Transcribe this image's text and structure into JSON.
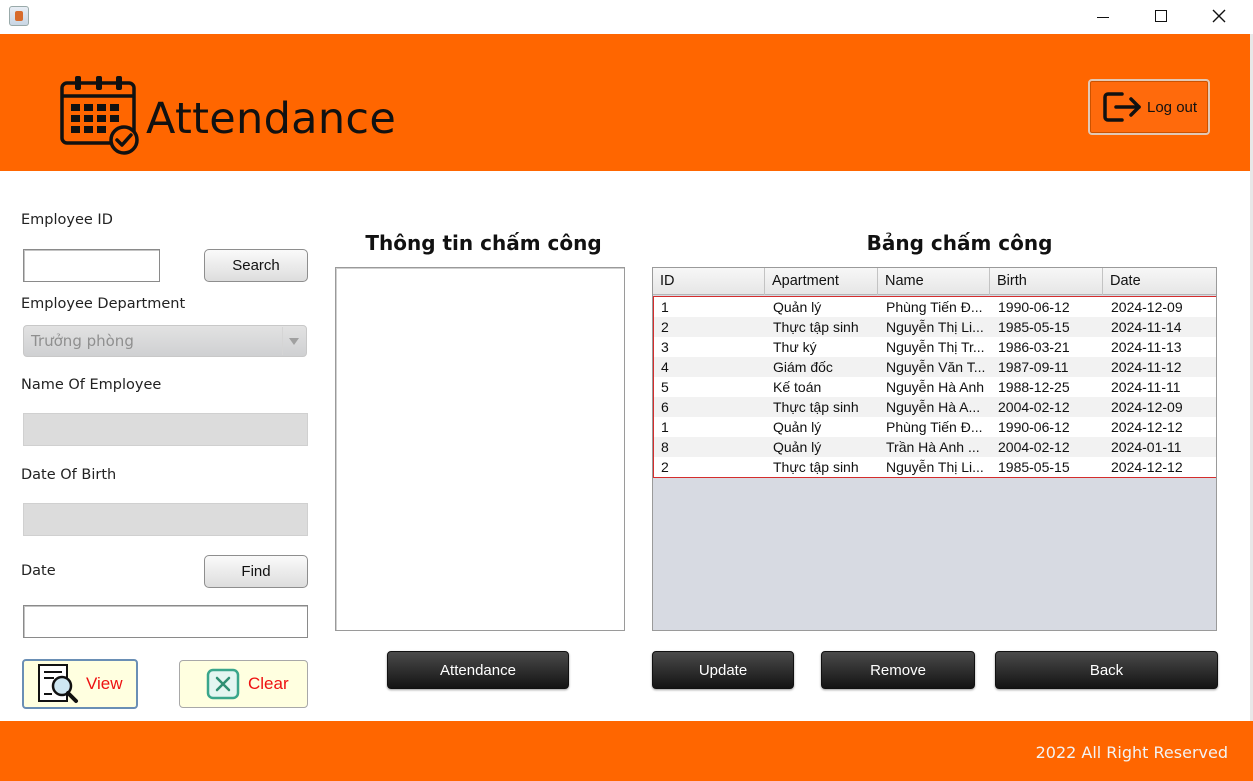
{
  "header": {
    "title": "Attendance",
    "logout_label": "Log out",
    "accent_color": "#ff6600"
  },
  "form": {
    "employee_id_label": "Employee ID",
    "employee_id_value": "",
    "search_label": "Search",
    "department_label": "Employee Department",
    "department_value": "Trưởng phòng",
    "name_label": "Name Of Employee",
    "name_value": "",
    "dob_label": "Date Of Birth",
    "dob_value": "",
    "date_label": "Date",
    "find_label": "Find",
    "date_value": "",
    "view_label": "View",
    "clear_label": "Clear"
  },
  "info_panel": {
    "title": "Thông tin chấm công",
    "attendance_button": "Attendance"
  },
  "table_panel": {
    "title": "Bảng chấm công",
    "columns": [
      "ID",
      "Apartment",
      "Name",
      "Birth",
      "Date"
    ],
    "rows": [
      [
        "1",
        "Quản lý",
        "Phùng Tiến Đ...",
        "1990-06-12",
        "2024-12-09"
      ],
      [
        "2",
        "Thực tập sinh",
        "Nguyễn Thị Li...",
        "1985-05-15",
        "2024-11-14"
      ],
      [
        "3",
        "Thư ký",
        "Nguyễn Thị Tr...",
        "1986-03-21",
        "2024-11-13"
      ],
      [
        "4",
        "Giám đốc",
        "Nguyễn Văn T...",
        "1987-09-11",
        "2024-11-12"
      ],
      [
        "5",
        "Kế toán",
        "Nguyễn Hà Anh",
        "1988-12-25",
        "2024-11-11"
      ],
      [
        "6",
        "Thực tập sinh",
        "Nguyễn Hà A...",
        "2004-02-12",
        "2024-12-09"
      ],
      [
        "1",
        "Quản lý",
        "Phùng Tiến Đ...",
        "1990-06-12",
        "2024-12-12"
      ],
      [
        "8",
        "Quản lý",
        "Trần Hà Anh ...",
        "2004-02-12",
        "2024-01-11"
      ],
      [
        "2",
        "Thực tập sinh",
        "Nguyễn Thị Li...",
        "1985-05-15",
        "2024-12-12"
      ]
    ],
    "update_button": "Update",
    "remove_button": "Remove",
    "back_button": "Back"
  },
  "footer": {
    "text": "2022 All Right Reserved"
  }
}
